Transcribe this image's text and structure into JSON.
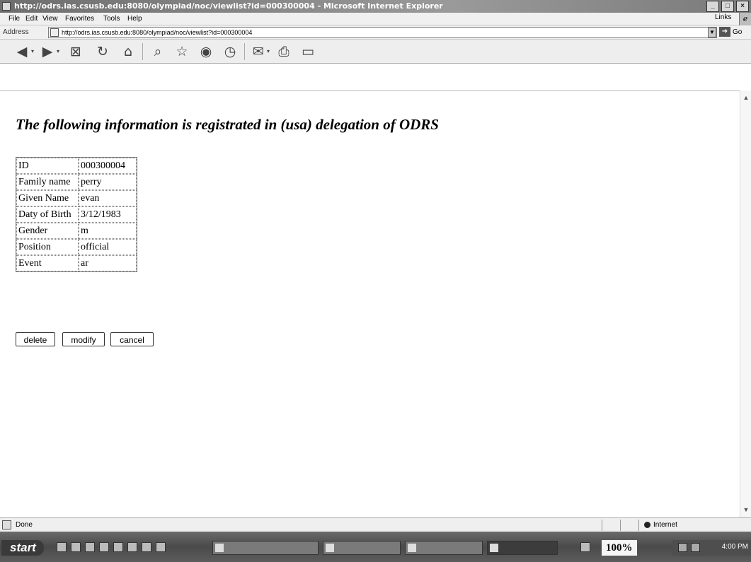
{
  "window": {
    "title": "http://odrs.ias.csusb.edu:8080/olympiad/noc/viewlist?id=000300004 - Microsoft Internet Explorer",
    "minimize_icon": "minimize-icon",
    "maximize_icon": "maximize-icon",
    "close_icon": "close-icon"
  },
  "menu": {
    "items": [
      "File",
      "Edit",
      "View",
      "Favorites",
      "Tools",
      "Help"
    ],
    "links_label": "Links"
  },
  "address": {
    "label": "Address",
    "url": "http://odrs.ias.csusb.edu:8080/olympiad/noc/viewlist?id=000300004",
    "go_label": "Go"
  },
  "toolbar": {
    "icons": [
      "back-icon",
      "forward-icon",
      "stop-icon",
      "refresh-icon",
      "home-icon",
      "search-icon",
      "favorites-icon",
      "media-icon",
      "history-icon",
      "mail-icon",
      "print-icon",
      "folder-icon"
    ]
  },
  "page": {
    "heading": "The following information is registrated in (usa) delegation of ODRS",
    "rows": [
      {
        "label": "ID",
        "value": "000300004"
      },
      {
        "label": "Family name",
        "value": "perry"
      },
      {
        "label": "Given Name",
        "value": "evan"
      },
      {
        "label": "Daty of Birth",
        "value": "3/12/1983"
      },
      {
        "label": "Gender",
        "value": "m"
      },
      {
        "label": "Position",
        "value": "official"
      },
      {
        "label": "Event",
        "value": "ar"
      }
    ],
    "buttons": {
      "delete": "delete",
      "modify": "modify",
      "cancel": "cancel"
    }
  },
  "status": {
    "text": "Done",
    "zone": "Internet"
  },
  "taskbar": {
    "start_label": "start",
    "zoom": "100%",
    "clock": "4:00 PM"
  }
}
